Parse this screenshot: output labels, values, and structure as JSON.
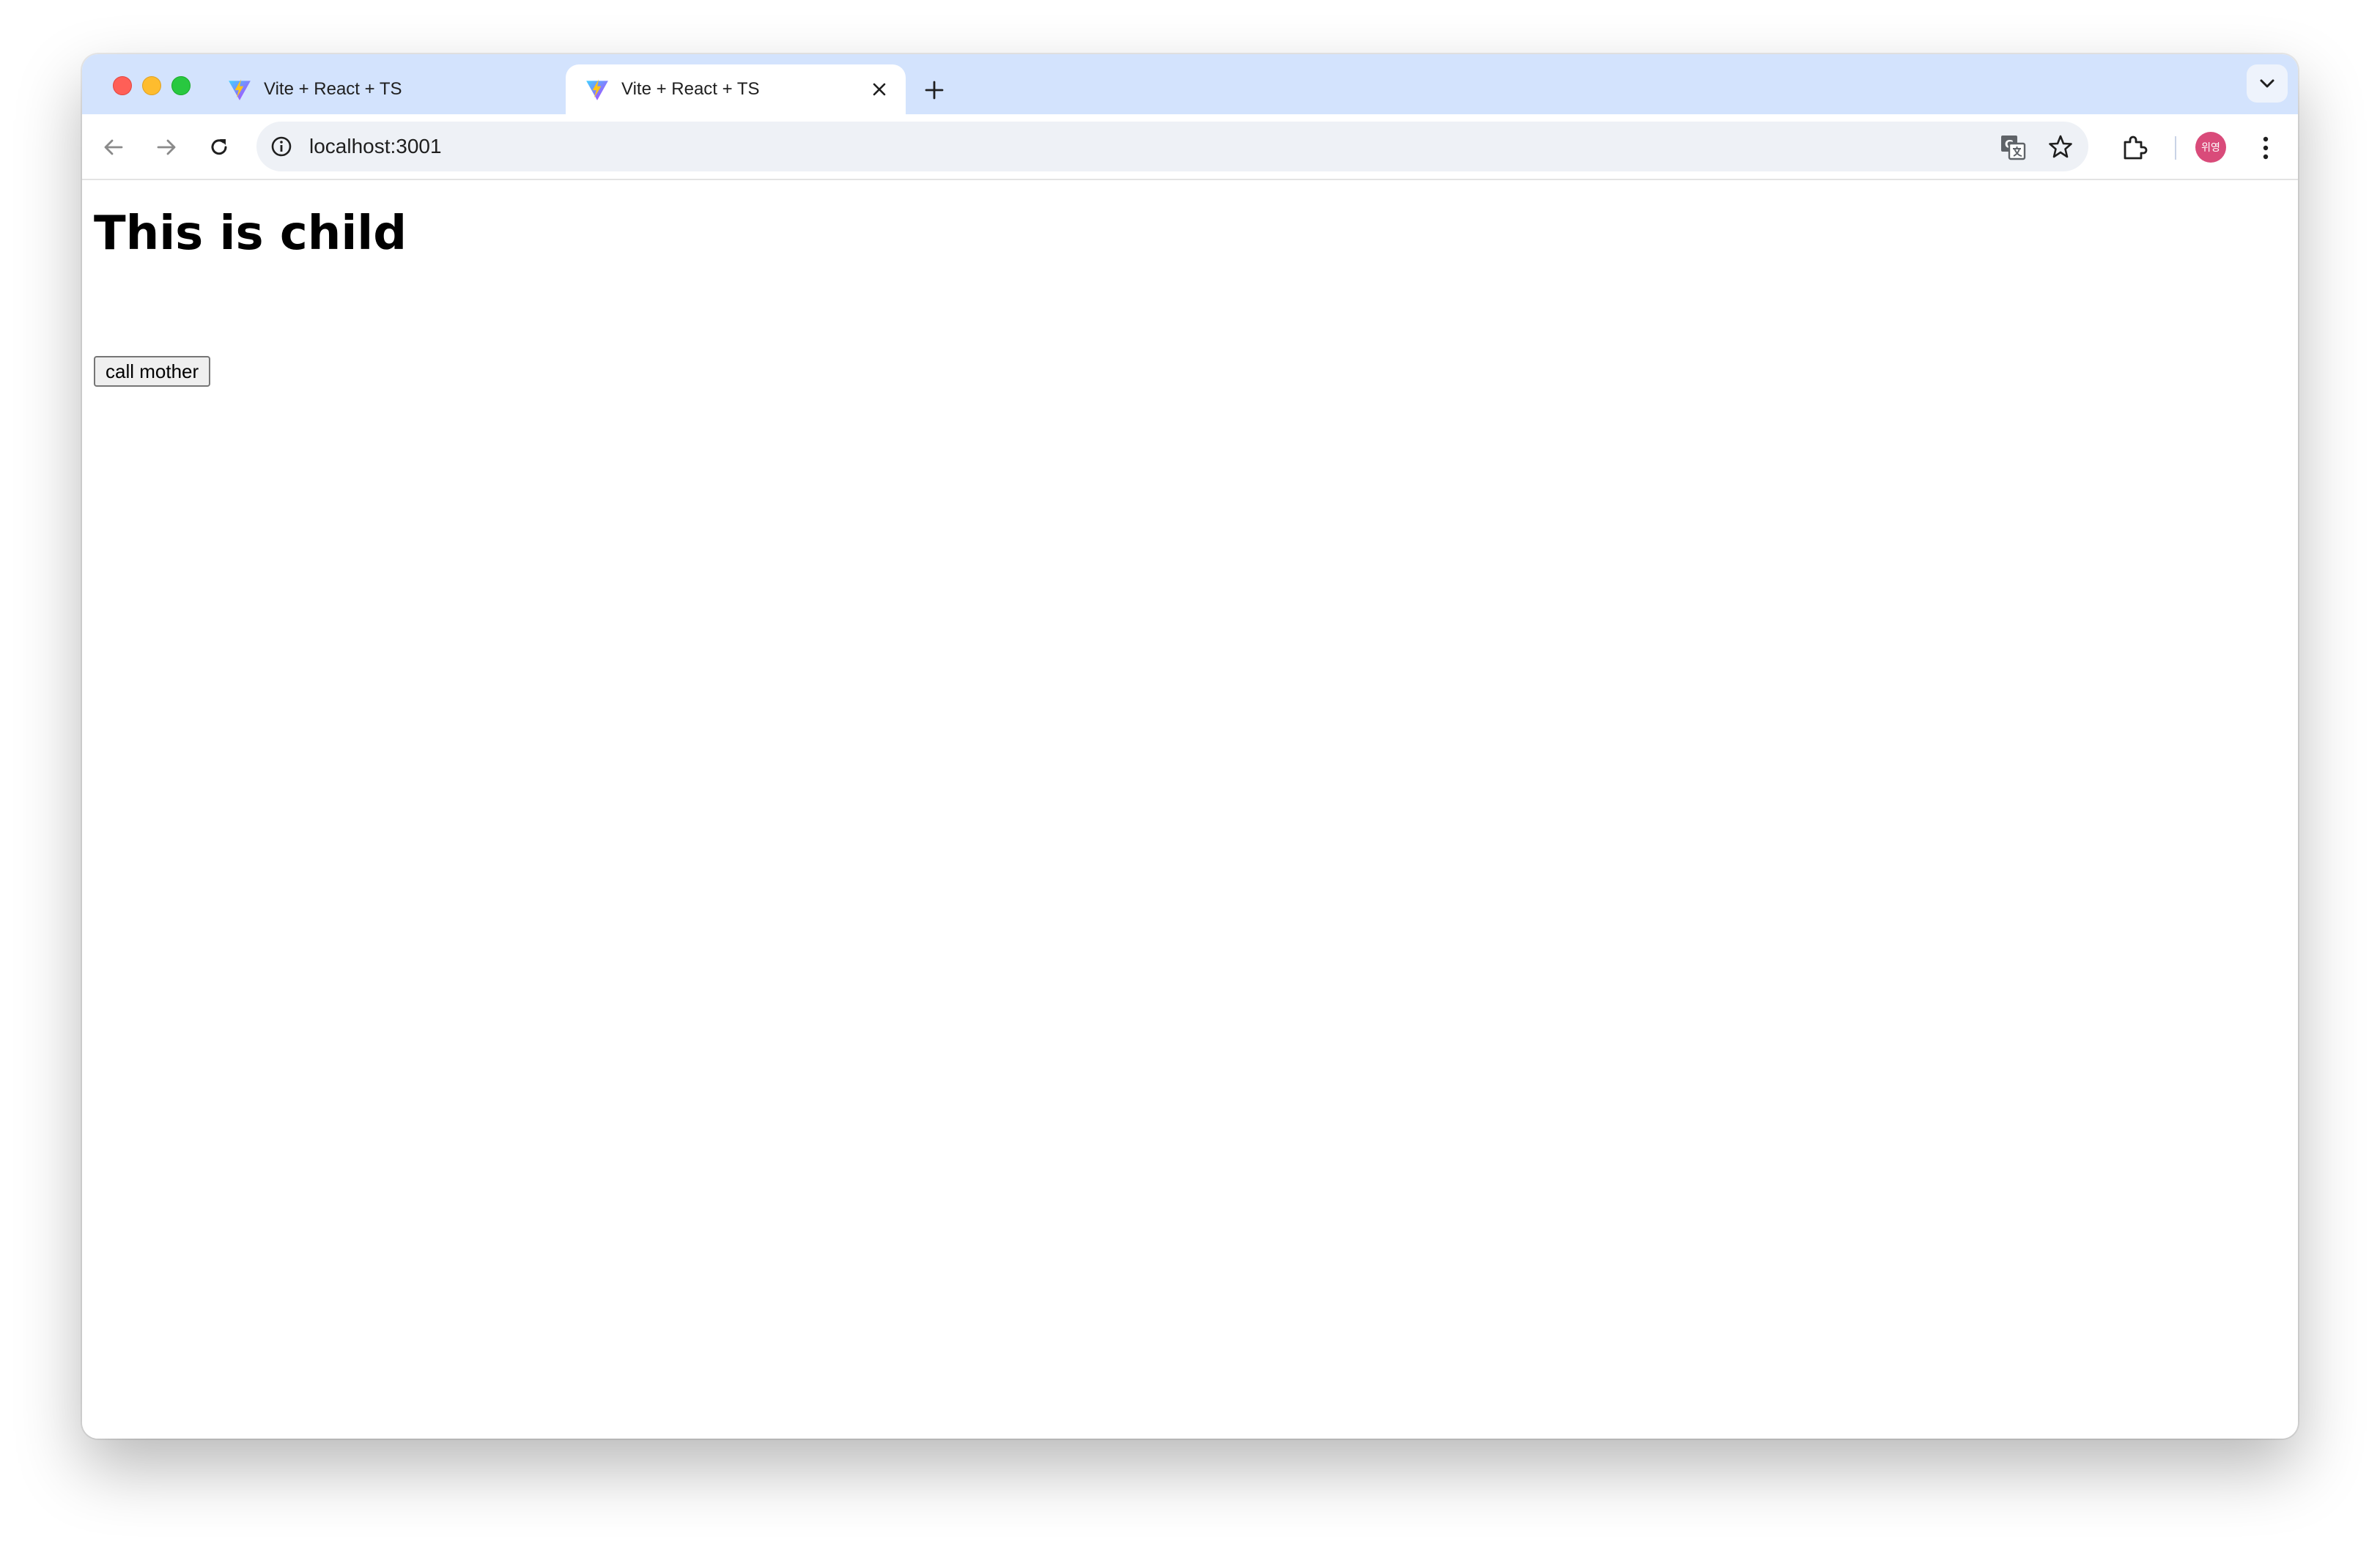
{
  "browser": {
    "tabs": [
      {
        "title": "Vite + React + TS",
        "active": false
      },
      {
        "title": "Vite + React + TS",
        "active": true
      }
    ],
    "address": "localhost:3001",
    "profile_initials": "위영",
    "colors": {
      "tabstrip": "#d3e3fd",
      "omnibox": "#eef1f6",
      "avatar": "#d94b7a"
    }
  },
  "page": {
    "heading": "This is child",
    "button_label": "call mother"
  }
}
